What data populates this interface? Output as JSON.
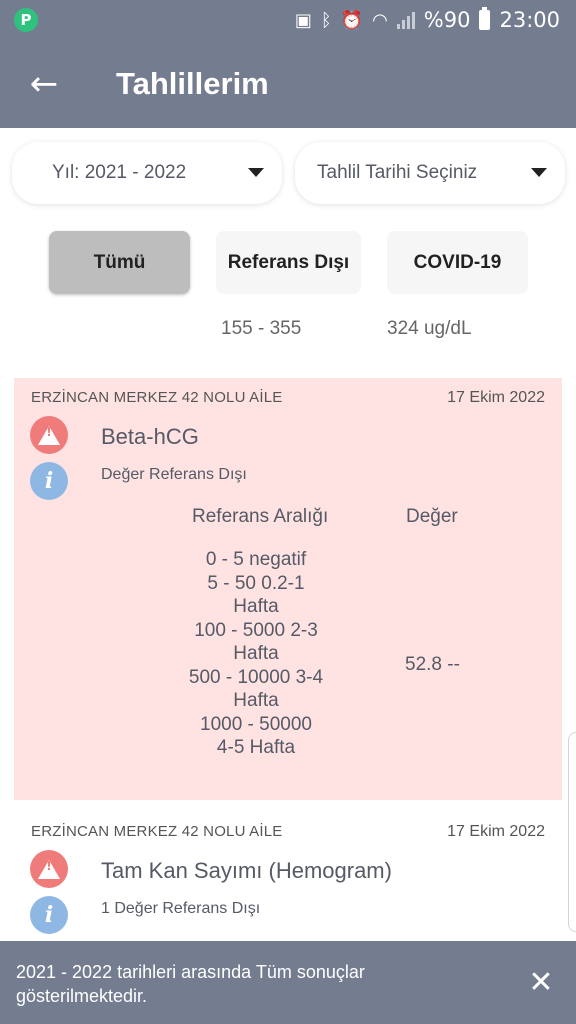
{
  "status_bar": {
    "app_icon": "P",
    "battery_percent": "%90",
    "time": "23:00",
    "icons": [
      "sim-icon",
      "bluetooth-icon",
      "alarm-icon",
      "wifi-icon",
      "signal-icon",
      "battery-icon"
    ]
  },
  "header": {
    "title": "Tahlillerim",
    "back_icon": "arrow-left-icon"
  },
  "filters": {
    "year_label": "Yıl: 2021 - 2022",
    "date_placeholder": "Tahlil Tarihi Seçiniz",
    "tabs": [
      {
        "label": "Tümü",
        "selected": true
      },
      {
        "label": "Referans Dışı",
        "selected": false
      },
      {
        "label": "COVID-19",
        "selected": false
      }
    ],
    "hint_ref": "155 - 355",
    "hint_covid": "324 ug/dL"
  },
  "results": [
    {
      "facility": "ERZİNCAN MERKEZ 42 NOLU AİLE",
      "date": "17 Ekim 2022",
      "test_name": "Beta-hCG",
      "status": "Değer Referans Dışı",
      "ref_header": "Referans Aralığı",
      "value_header": "Değer",
      "ref_range": "0 - 5   negatif\n  5 - 50  0.2-1\nHafta\n100 - 5000  2-3\nHafta\n500 - 10000  3-4\nHafta\n1000 - 50000\n4-5 Hafta",
      "value": "52.8 --",
      "highlight_color": "#ffe3e3"
    },
    {
      "facility": "ERZİNCAN MERKEZ 42 NOLU AİLE",
      "date": "17 Ekim 2022",
      "test_name": "Tam Kan Sayımı (Hemogram)",
      "status": "1 Değer Referans Dışı"
    }
  ],
  "snackbar": {
    "message": "2021 - 2022 tarihleri arasında Tüm sonuçlar gösterilmektedir.",
    "close_icon": "close-icon"
  },
  "colors": {
    "bar": "#747c8f",
    "warning": "#f07b7b",
    "info": "#8eb8e3",
    "tab_selected": "#bdbdbd"
  }
}
